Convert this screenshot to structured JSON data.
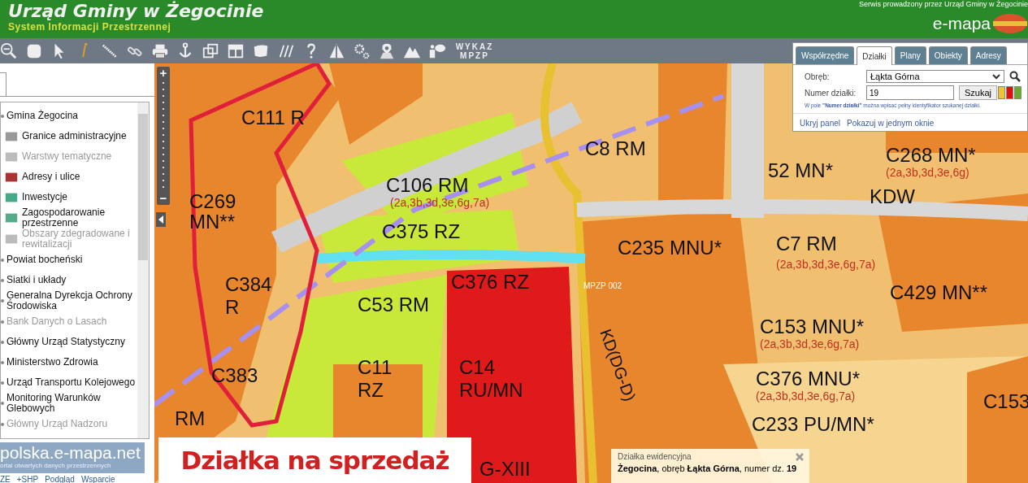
{
  "header": {
    "title": "Urząd Gminy w Żegocinie",
    "subtitle": "System Informacji Przestrzennej",
    "operator": "Serwis prowadzony przez Urząd Gminy w Żegocinie",
    "logo": "e-mapa"
  },
  "toolbar": {
    "list_button": "WYKAZ MPZP"
  },
  "sidebar": {
    "items": [
      {
        "label": "Gmina Żegocina",
        "kind": "group",
        "disabled": false
      },
      {
        "label": "Granice administracyjne",
        "kind": "layer",
        "disabled": false
      },
      {
        "label": "Warstwy tematyczne",
        "kind": "layer",
        "disabled": true
      },
      {
        "label": "Adresy i ulice",
        "kind": "layer",
        "disabled": false
      },
      {
        "label": "Inwestycje",
        "kind": "layer",
        "disabled": false
      },
      {
        "label": "Zagospodarowanie przestrzenne",
        "kind": "layer",
        "disabled": false
      },
      {
        "label": "Obszary zdegradowane i rewitalizacji",
        "kind": "layer",
        "disabled": true
      },
      {
        "label": "Powiat bocheński",
        "kind": "group",
        "disabled": false
      },
      {
        "label": "Siatki i układy",
        "kind": "group",
        "disabled": false
      },
      {
        "label": "Generalna Dyrekcja Ochrony Środowiska",
        "kind": "group",
        "disabled": false
      },
      {
        "label": "Bank Danych o Lasach",
        "kind": "group",
        "disabled": true
      },
      {
        "label": "Główny Urząd Statystyczny",
        "kind": "group",
        "disabled": false
      },
      {
        "label": "Ministerstwo Zdrowia",
        "kind": "group",
        "disabled": false
      },
      {
        "label": "Urząd Transportu Kolejowego",
        "kind": "group",
        "disabled": false
      },
      {
        "label": "Monitoring Warunków Glebowych",
        "kind": "group",
        "disabled": false
      },
      {
        "label": "Główny Urząd Nadzoru",
        "kind": "group",
        "disabled": true
      }
    ],
    "portal": {
      "title": "polska.e-mapa.net",
      "tagline": "ortal otwartych danych przestrzennych"
    },
    "links": [
      "ZE",
      "+SHP",
      "Podgląd",
      "Wsparcie"
    ]
  },
  "map": {
    "labels": [
      {
        "text": "C111 R",
        "kind": "zone"
      },
      {
        "text": "C269",
        "kind": "zone"
      },
      {
        "text": "MN**",
        "kind": "zone"
      },
      {
        "text": "C106 RM",
        "kind": "zone"
      },
      {
        "text": "(2a,3b,3d,3e,6g,7a)",
        "kind": "detail"
      },
      {
        "text": "C375 RZ",
        "kind": "zone"
      },
      {
        "text": "C8 RM",
        "kind": "zone"
      },
      {
        "text": "52 MN*",
        "kind": "zone"
      },
      {
        "text": "C268 MN*",
        "kind": "zone"
      },
      {
        "text": "(2a,3b,3d,3e,6g)",
        "kind": "detail"
      },
      {
        "text": "KDW",
        "kind": "zone"
      },
      {
        "text": "C235 MNU*",
        "kind": "zone"
      },
      {
        "text": "C7 RM",
        "kind": "zone"
      },
      {
        "text": "(2a,3b,3d,3e,6g,7a)",
        "kind": "detail"
      },
      {
        "text": "C384",
        "kind": "zone"
      },
      {
        "text": "C376 RZ",
        "kind": "zone"
      },
      {
        "text": "R",
        "kind": "zone"
      },
      {
        "text": "C53 RM",
        "kind": "zone"
      },
      {
        "text": "C429 MN**",
        "kind": "zone"
      },
      {
        "text": "C153 MNU*",
        "kind": "zone"
      },
      {
        "text": "(2a,3b,3d,3e,6g,7a)",
        "kind": "detail"
      },
      {
        "text": "C11",
        "kind": "zone"
      },
      {
        "text": "RZ",
        "kind": "zone"
      },
      {
        "text": "C14",
        "kind": "zone"
      },
      {
        "text": "RU/MN",
        "kind": "zone"
      },
      {
        "text": "C376 MNU*",
        "kind": "zone"
      },
      {
        "text": "(2a,3b,3d,3e,6g,7a)",
        "kind": "detail"
      },
      {
        "text": "C383",
        "kind": "zone"
      },
      {
        "text": "RM",
        "kind": "zone"
      },
      {
        "text": "C233 PU/MN*",
        "kind": "zone"
      },
      {
        "text": "C153",
        "kind": "zone"
      },
      {
        "text": "G-XIII",
        "kind": "zone"
      },
      {
        "text": "KD(DG-D)",
        "kind": "road"
      },
      {
        "text": "MPZP 002",
        "kind": "tag"
      }
    ],
    "banner": "Działka na sprzedaż",
    "zoom": {
      "in": "+",
      "out": "−"
    }
  },
  "search_panel": {
    "tabs": [
      {
        "label": "Współrzędne",
        "selected": false
      },
      {
        "label": "Działki",
        "selected": true
      },
      {
        "label": "Plany",
        "selected": false
      },
      {
        "label": "Obiekty",
        "selected": false
      },
      {
        "label": "Adresy",
        "selected": false
      }
    ],
    "precinct_label": "Obręb:",
    "precinct": "Łąkta Górna",
    "number_label": "Numer działki:",
    "number": "19",
    "search_button": "Szukaj",
    "swatches": [
      {
        "color": "#f2c230"
      },
      {
        "color": "#e01010"
      },
      {
        "color": "#6aaa2a"
      }
    ],
    "hint": "W pole **\"Numer działki\"** można wpisać pełny identyfikator szukanej działki.",
    "links": [
      "Ukryj panel",
      "Pokazuj w jednym oknie"
    ]
  },
  "popup": {
    "title": "Działka ewidencyjna",
    "text": "**Żegocina**, obręb **Łąkta Górna**, numer dz. **19**"
  }
}
